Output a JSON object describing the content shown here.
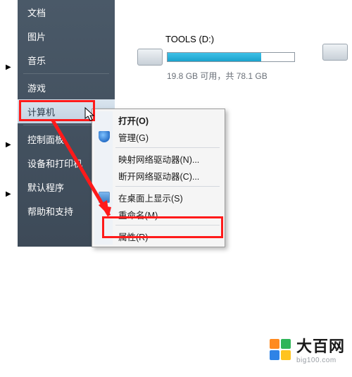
{
  "sidebar": {
    "items": [
      {
        "label": "文档"
      },
      {
        "label": "图片"
      },
      {
        "label": "音乐"
      },
      {
        "label": "游戏"
      },
      {
        "label": "计算机"
      },
      {
        "label": "控制面板"
      },
      {
        "label": "设备和打印机"
      },
      {
        "label": "默认程序"
      },
      {
        "label": "帮助和支持"
      }
    ]
  },
  "drive": {
    "title": "TOOLS (D:)",
    "subtitle": "19.8 GB 可用，共 78.1 GB",
    "fill_percent": 74
  },
  "context": {
    "open": "打开(O)",
    "manage": "管理(G)",
    "map_drive": "映射网络驱动器(N)...",
    "disconnect_drive": "断开网络驱动器(C)...",
    "show_desktop": "在桌面上显示(S)",
    "rename": "重命名(M)",
    "properties": "属性(R)"
  },
  "logo": {
    "text": "大百网",
    "sub": "big100.com",
    "colors": {
      "a": "#ff8a1f",
      "b": "#2fb558",
      "c": "#2f83e6",
      "d": "#ffc41f"
    }
  }
}
